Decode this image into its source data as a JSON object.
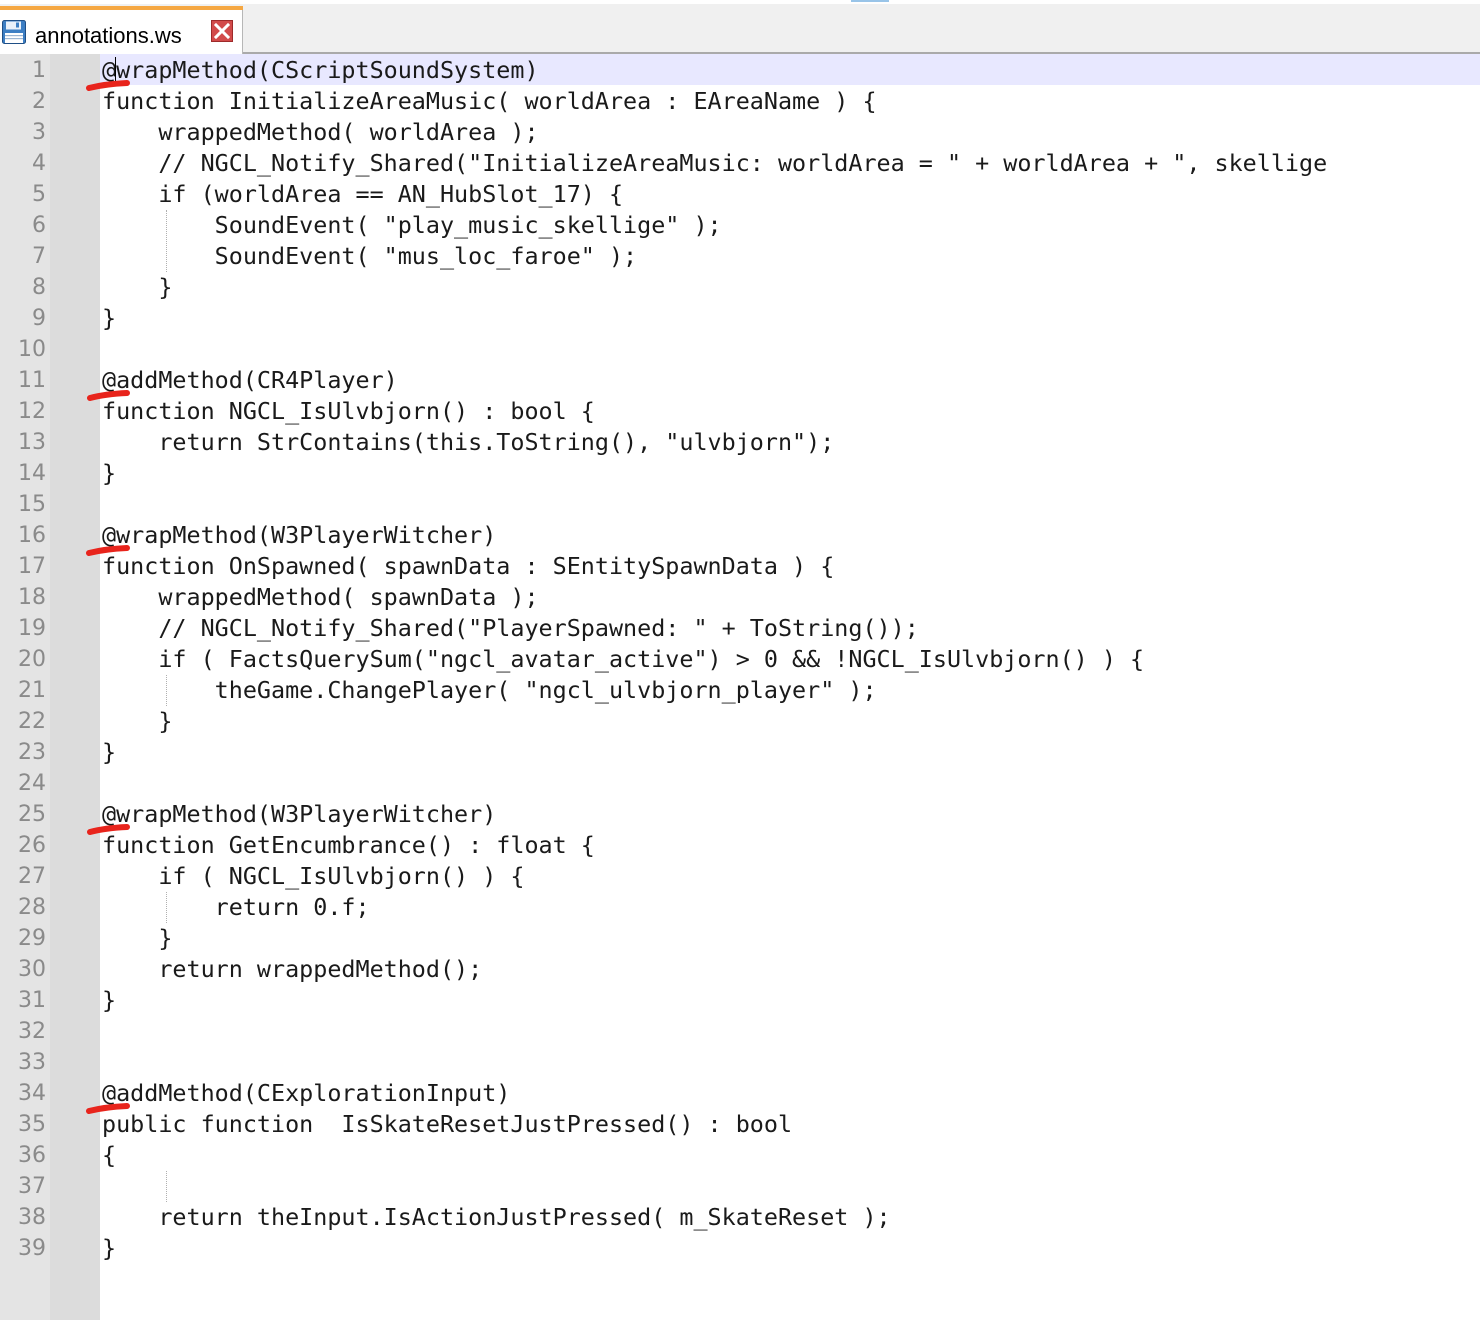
{
  "tab": {
    "filename": "annotations.ws",
    "save_icon": "floppy-disk-icon",
    "close_icon": "close-icon"
  },
  "editor": {
    "current_line": 1,
    "lines": [
      "@wrapMethod(CScriptSoundSystem)",
      "function InitializeAreaMusic( worldArea : EAreaName ) {",
      "    wrappedMethod( worldArea );",
      "    // NGCL_Notify_Shared(\"InitializeAreaMusic: worldArea = \" + worldArea + \", skellige",
      "    if (worldArea == AN_HubSlot_17) {",
      "        SoundEvent( \"play_music_skellige\" );",
      "        SoundEvent( \"mus_loc_faroe\" );",
      "    }",
      "}",
      "",
      "@addMethod(CR4Player)",
      "function NGCL_IsUlvbjorn() : bool {",
      "    return StrContains(this.ToString(), \"ulvbjorn\");",
      "}",
      "",
      "@wrapMethod(W3PlayerWitcher)",
      "function OnSpawned( spawnData : SEntitySpawnData ) {",
      "    wrappedMethod( spawnData );",
      "    // NGCL_Notify_Shared(\"PlayerSpawned: \" + ToString());",
      "    if ( FactsQuerySum(\"ngcl_avatar_active\") > 0 && !NGCL_IsUlvbjorn() ) {",
      "        theGame.ChangePlayer( \"ngcl_ulvbjorn_player\" );",
      "    }",
      "}",
      "",
      "@wrapMethod(W3PlayerWitcher)",
      "function GetEncumbrance() : float {",
      "    if ( NGCL_IsUlvbjorn() ) {",
      "        return 0.f;",
      "    }",
      "    return wrappedMethod();",
      "}",
      "",
      "",
      "@addMethod(CExplorationInput)",
      "public function  IsSkateResetJustPressed() : bool",
      "{",
      "",
      "    return theInput.IsActionJustPressed( m_SkateReset );",
      "}"
    ]
  },
  "annotations": {
    "mark_color": "#e8241c",
    "marked_lines": [
      1,
      11,
      16,
      25,
      34
    ]
  }
}
